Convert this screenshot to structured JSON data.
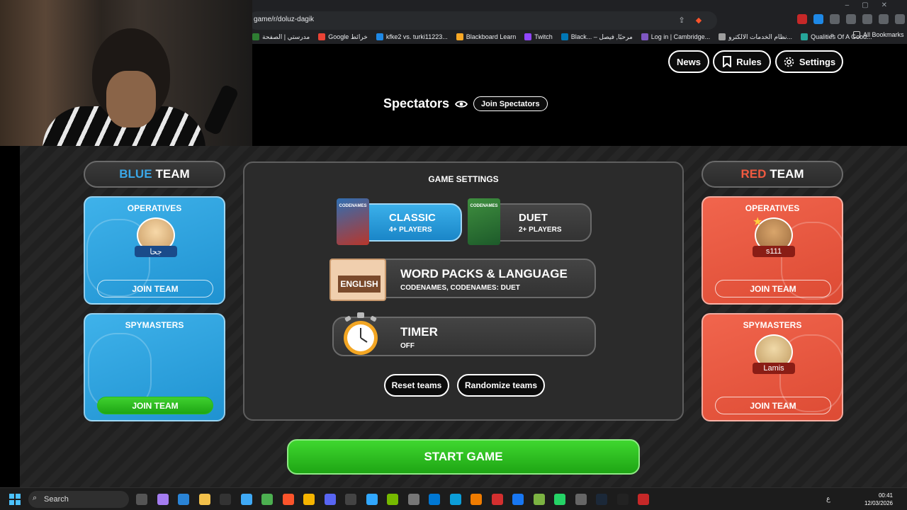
{
  "browser": {
    "url": "game/r/doluz-dagik",
    "bookmarks": [
      {
        "label": "مدرستي | الصفحة",
        "color": "#2e7d32"
      },
      {
        "label": "Google خرائط",
        "color": "#ea4335"
      },
      {
        "label": "kfke2 vs. turki11223...",
        "color": "#1e88e5"
      },
      {
        "label": "Blackboard Learn",
        "color": "#f9a825"
      },
      {
        "label": "Twitch",
        "color": "#9146ff"
      },
      {
        "label": "Black... – مرحبًا, فيصل",
        "color": "#0077b5"
      },
      {
        "label": "Log in | Cambridge...",
        "color": "#7e57c2"
      },
      {
        "label": "نظام الخدمات الالكترو...",
        "color": "#9e9e9e"
      },
      {
        "label": "Qualities Of A Good...",
        "color": "#26a69a"
      }
    ],
    "more_label": "»",
    "all_bookmarks_label": "All Bookmarks"
  },
  "nav": {
    "news": "News",
    "rules": "Rules",
    "settings": "Settings"
  },
  "spectators": {
    "label": "Spectators",
    "join": "Join Spectators"
  },
  "blue_team": {
    "title_color_word": "BLUE",
    "title_word": "TEAM",
    "color": "#3aa7e8",
    "operatives_title": "OPERATIVES",
    "operative_name": "جحا",
    "operatives_join": "JOIN TEAM",
    "spymasters_title": "SPYMASTERS",
    "spymasters_join": "JOIN TEAM"
  },
  "red_team": {
    "title_color_word": "RED",
    "title_word": "TEAM",
    "color": "#f05a40",
    "operatives_title": "OPERATIVES",
    "operative_name": "s111",
    "operatives_join": "JOIN TEAM",
    "spymasters_title": "SPYMASTERS",
    "spymaster_name": "Lamis",
    "spymasters_join": "JOIN TEAM"
  },
  "game_settings": {
    "title": "GAME SETTINGS",
    "classic": {
      "name": "CLASSIC",
      "players": "4+ PLAYERS",
      "box_text": "CODENAMES"
    },
    "duet": {
      "name": "DUET",
      "players": "2+ PLAYERS",
      "box_text": "CODENAMES"
    },
    "word_packs": {
      "title": "WORD PACKS & LANGUAGE",
      "value": "CODENAMES, CODENAMES: DUET",
      "badge": "ENGLISH"
    },
    "timer": {
      "title": "TIMER",
      "value": "OFF"
    },
    "reset_teams": "Reset teams",
    "randomize_teams": "Randomize teams"
  },
  "start_game": "START GAME",
  "taskbar": {
    "search_label": "Search",
    "lang": "ع",
    "time": "00:41",
    "date": "12/03/2026",
    "apps": [
      "task-view",
      "copilot",
      "store",
      "file-explorer",
      "epic-games",
      "notepad",
      "chrome",
      "brave",
      "rockstar",
      "discord",
      "obs",
      "photoshop",
      "nvidia",
      "mail",
      "paint",
      "edge",
      "vlc",
      "acrobat",
      "facebook",
      "minecraft",
      "whatsapp",
      "steam-workshop",
      "steam",
      "epic",
      "news-app"
    ]
  }
}
